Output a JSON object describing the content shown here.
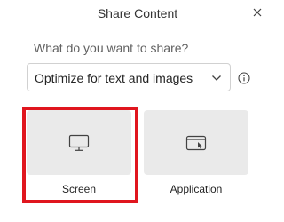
{
  "dialog": {
    "title": "Share Content",
    "close_icon": "close-icon"
  },
  "question": "What do you want to share?",
  "optimize_select": {
    "selected": "Optimize for text and images",
    "icon": "chevron-down-icon"
  },
  "info_icon": "info-icon",
  "share_options": [
    {
      "label": "Screen",
      "icon": "monitor-icon",
      "selected": true
    },
    {
      "label": "Application",
      "icon": "app-window-icon",
      "selected": false
    }
  ],
  "colors": {
    "highlight": "#e0161e",
    "tile_background": "#eaeaea"
  }
}
